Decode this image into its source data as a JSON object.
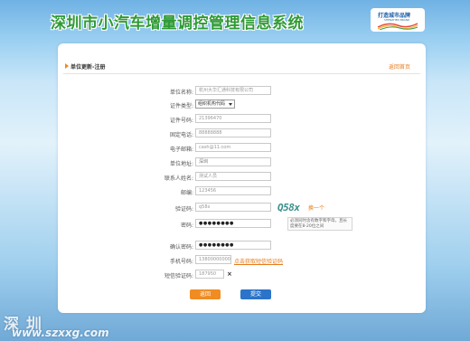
{
  "header": {
    "site_title": "深圳市小汽车增量调控管理信息系统",
    "logo_text": "打造城市品牌",
    "logo_sub": "SHENZHEN BRAND"
  },
  "panel": {
    "title": "单位更新-注册",
    "back_link": "返回首页"
  },
  "form": {
    "fields": [
      {
        "label": "单位名称:",
        "value": "杭州大华汇通科技有限公司"
      },
      {
        "label": "证件类型:",
        "value": "组织机构代码"
      },
      {
        "label": "证件号码:",
        "value": "21396470"
      },
      {
        "label": "固定电话:",
        "value": "88888888"
      },
      {
        "label": "电子邮箱:",
        "value": "cash@11.com"
      },
      {
        "label": "单位地址:",
        "value": "深圳"
      },
      {
        "label": "联系人姓名:",
        "value": "测试人员"
      },
      {
        "label": "邮编:",
        "value": "123456"
      },
      {
        "label": "验证码:",
        "value": "q58x"
      },
      {
        "label": "密码:",
        "value": "●●●●●●●●"
      },
      {
        "label": "确认密码:",
        "value": "●●●●●●●●"
      },
      {
        "label": "手机号码:",
        "value": "13800000000"
      },
      {
        "label": "短信验证码:",
        "value": "187950"
      }
    ],
    "captcha_image_text": "Q58x",
    "captcha_refresh": "换一个",
    "password_hint": "必须同时含有数字和字母，且长度要在8-20位之间",
    "sms_link": "点击获取短信验证码",
    "clear_icon_glyph": "×"
  },
  "buttons": {
    "back": "返回",
    "submit": "提交"
  },
  "watermark": {
    "text": "深 圳",
    "url": "www.szxxg.com"
  },
  "colors": {
    "title_green": "#2f9a35",
    "accent_orange": "#f08c22",
    "submit_blue": "#2b74c9",
    "link_orange": "#e77a1a"
  }
}
